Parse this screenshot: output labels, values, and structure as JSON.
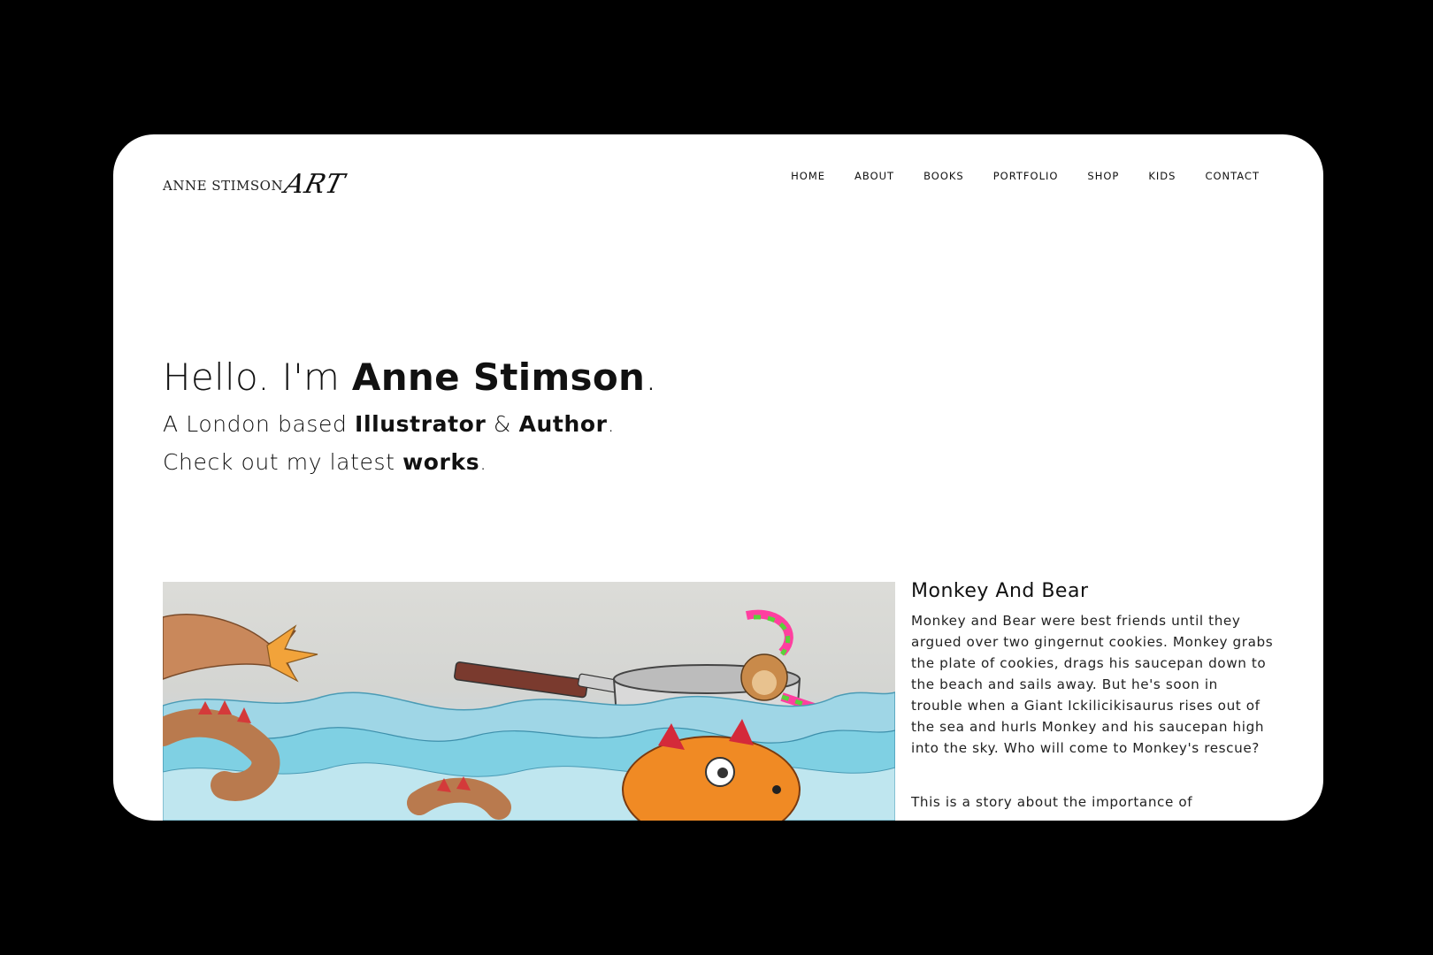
{
  "logo": {
    "name": "ANNE STIMSON",
    "art": "ART"
  },
  "nav": {
    "items": [
      {
        "label": "HOME"
      },
      {
        "label": "ABOUT"
      },
      {
        "label": "BOOKS"
      },
      {
        "label": "PORTFOLIO"
      },
      {
        "label": "SHOP"
      },
      {
        "label": "KIDS"
      },
      {
        "label": "CONTACT"
      }
    ]
  },
  "hero": {
    "greeting": "Hello. I'm ",
    "name": "Anne Stimson",
    "name_suffix": ".",
    "line1_a": "A London based ",
    "line1_b": "Illustrator",
    "line1_c": " & ",
    "line1_d": "Author",
    "line1_e": ".",
    "line2_a": "Check out my latest ",
    "line2_b": "works",
    "line2_c": "."
  },
  "feature": {
    "title": "Monkey And Bear",
    "description": "Monkey and Bear were best friends until they argued over two gingernut cookies. Monkey grabs the plate of cookies, drags his saucepan down to the beach and sails away. But he's soon in trouble when a Giant Ickilicikisaurus rises out of the sea and hurls Monkey and his saucepan high into the sky. Who will come to Monkey's rescue?",
    "description_2": "This is a story about the importance of",
    "artwork_alt": "Monkey And Bear illustration"
  },
  "colors": {
    "background": "#000000",
    "page": "#ffffff",
    "text": "#111111",
    "wave": "#7fd0e3",
    "fish": "#f08a24",
    "scarf_pink": "#ff3fa0",
    "scarf_green": "#5ad13a"
  }
}
